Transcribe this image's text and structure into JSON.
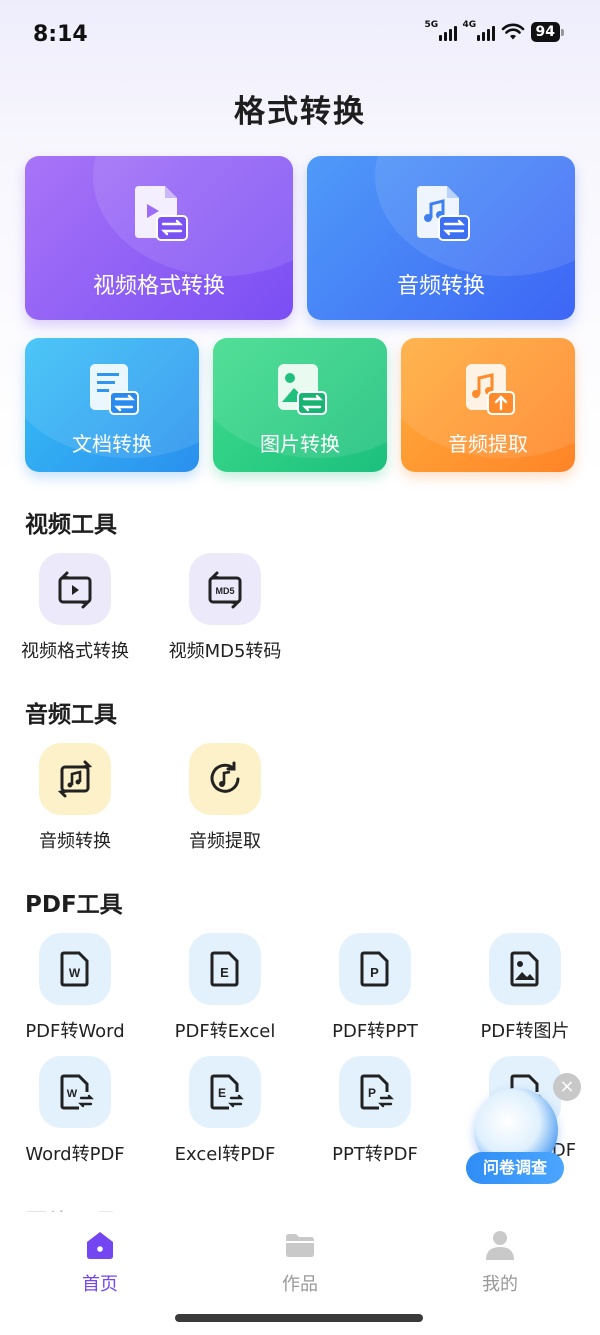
{
  "status": {
    "time": "8:14",
    "net1": "5G",
    "net2": "4G",
    "battery": "94"
  },
  "header": {
    "title": "格式转换"
  },
  "cards": {
    "video_convert": "视频格式转换",
    "audio_convert": "音频转换",
    "doc_convert": "文档转换",
    "image_convert": "图片转换",
    "audio_extract": "音频提取"
  },
  "sections": {
    "video": {
      "title": "视频工具",
      "items": [
        {
          "label": "视频格式转换",
          "icon": "video-convert-icon"
        },
        {
          "label": "视频MD5转码",
          "icon": "md5-icon"
        }
      ]
    },
    "audio": {
      "title": "音频工具",
      "items": [
        {
          "label": "音频转换",
          "icon": "audio-convert-icon"
        },
        {
          "label": "音频提取",
          "icon": "audio-extract-icon"
        }
      ]
    },
    "pdf": {
      "title": "PDF工具",
      "items": [
        {
          "label": "PDF转Word",
          "icon": "word-file-icon"
        },
        {
          "label": "PDF转Excel",
          "icon": "excel-file-icon"
        },
        {
          "label": "PDF转PPT",
          "icon": "ppt-file-icon"
        },
        {
          "label": "PDF转图片",
          "icon": "image-file-icon"
        },
        {
          "label": "Word转PDF",
          "icon": "word-to-pdf-icon"
        },
        {
          "label": "Excel转PDF",
          "icon": "excel-to-pdf-icon"
        },
        {
          "label": "PPT转PDF",
          "icon": "ppt-to-pdf-icon"
        },
        {
          "label": "DF",
          "icon": "image-to-pdf-icon"
        }
      ]
    },
    "next": {
      "title": "图片工具"
    }
  },
  "survey": {
    "label": "问卷调查",
    "close": "×"
  },
  "tabbar": {
    "home": "首页",
    "works": "作品",
    "mine": "我的"
  },
  "colors": {
    "accent": "#7346f2",
    "inactive": "#999999"
  }
}
